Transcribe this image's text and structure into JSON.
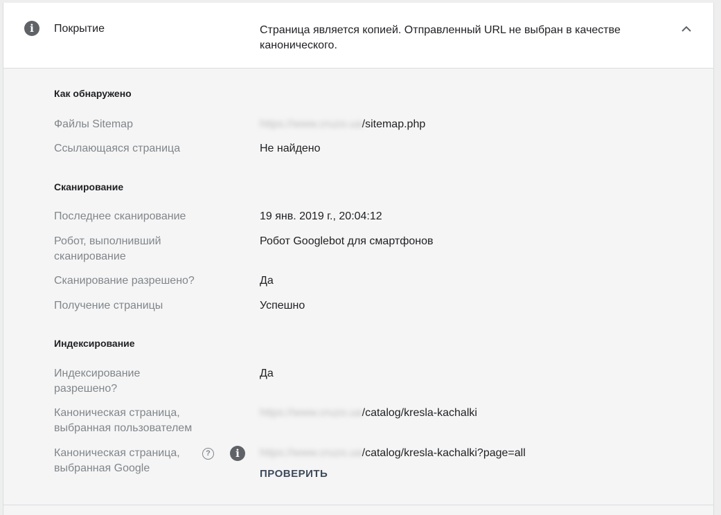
{
  "header": {
    "title": "Покрытие",
    "description": "Страница является копией. Отправленный URL не выбран в качестве канонического."
  },
  "sections": {
    "discovery": {
      "title": "Как обнаружено",
      "sitemaps_label": "Файлы Sitemap",
      "sitemaps_value_blurred": "https://www.cruzo.ua",
      "sitemaps_value": "/sitemap.php",
      "referring_label": "Ссылающаяся страница",
      "referring_value": "Не найдено"
    },
    "crawl": {
      "title": "Сканирование",
      "last_crawl_label": "Последнее сканирование",
      "last_crawl_value": "19 янв. 2019 г., 20:04:12",
      "crawler_label": "Робот, выполнивший сканирование",
      "crawler_value": "Робот Googlebot для смартфонов",
      "allowed_label": "Сканирование разрешено?",
      "allowed_value": "Да",
      "fetch_label": "Получение страницы",
      "fetch_value": "Успешно"
    },
    "indexing": {
      "title": "Индексирование",
      "allowed_label": "Индексирование разрешено?",
      "allowed_value": "Да",
      "user_canonical_label": "Каноническая страница, выбранная пользователем",
      "user_canonical_blurred": "https://www.cruzo.ua",
      "user_canonical_value": "/catalog/kresla-kachalki",
      "google_canonical_label": "Каноническая страница, выбранная Google",
      "google_canonical_blurred": "https://www.cruzo.ua",
      "google_canonical_value": "/catalog/kresla-kachalki?page=all",
      "check_button": "ПРОВЕРИТЬ"
    }
  },
  "icons": {
    "info": "info-icon",
    "help": "help-icon",
    "chevron": "chevron-up-icon"
  }
}
